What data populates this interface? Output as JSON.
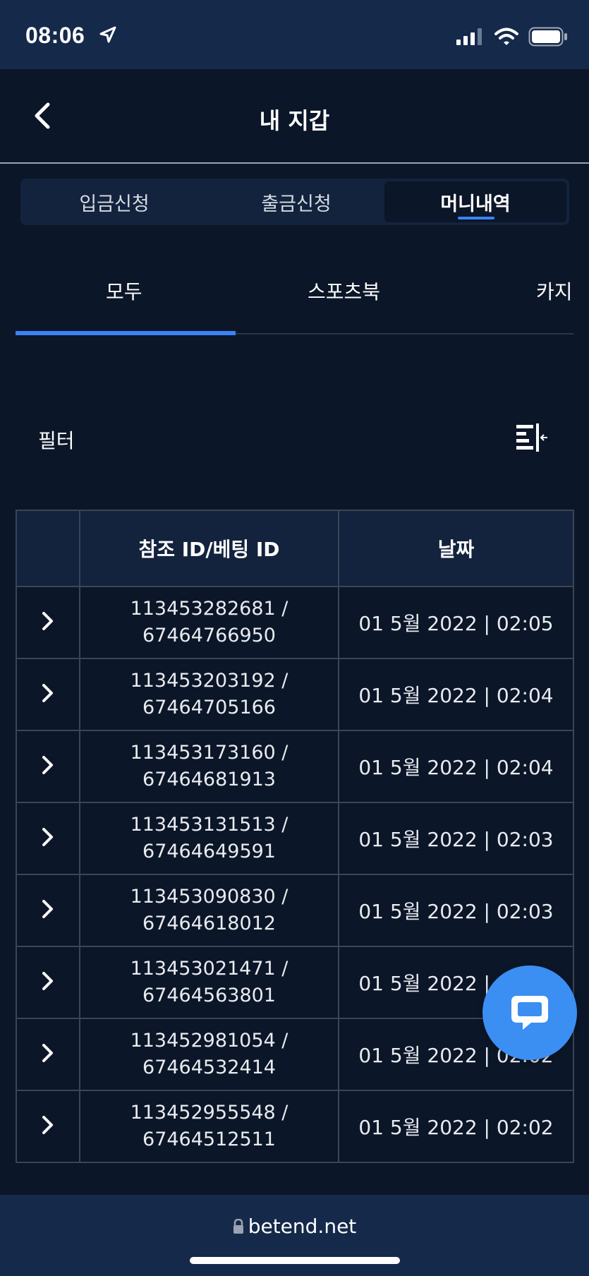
{
  "status": {
    "time": "08:06"
  },
  "header": {
    "title": "내 지갑"
  },
  "segment": {
    "items": [
      "입금신청",
      "출금신청",
      "머니내역"
    ],
    "active_index": 2
  },
  "tabs": {
    "items": [
      "모두",
      "스포츠북",
      "카지"
    ],
    "active_index": 0
  },
  "filter": {
    "label": "필터"
  },
  "table": {
    "headers": [
      "",
      "참조 ID/베팅 ID",
      "날짜"
    ],
    "rows": [
      {
        "ref_id": "113453282681 /",
        "bet_id": "67464766950",
        "date": "01 5월 2022 | 02:05"
      },
      {
        "ref_id": "113453203192 /",
        "bet_id": "67464705166",
        "date": "01 5월 2022 | 02:04"
      },
      {
        "ref_id": "113453173160 /",
        "bet_id": "67464681913",
        "date": "01 5월 2022 | 02:04"
      },
      {
        "ref_id": "113453131513 /",
        "bet_id": "67464649591",
        "date": "01 5월 2022 | 02:03"
      },
      {
        "ref_id": "113453090830 /",
        "bet_id": "67464618012",
        "date": "01 5월 2022 | 02:03"
      },
      {
        "ref_id": "113453021471 /",
        "bet_id": "67464563801",
        "date": "01 5월 2022 | 02:03"
      },
      {
        "ref_id": "113452981054 /",
        "bet_id": "67464532414",
        "date": "01 5월 2022 | 02:02"
      },
      {
        "ref_id": "113452955548 /",
        "bet_id": "67464512511",
        "date": "01 5월 2022 | 02:02"
      }
    ]
  },
  "browser": {
    "url": "betend.net"
  },
  "colors": {
    "background": "#0b1628",
    "header_bg": "#13233d",
    "accent": "#3b82f6",
    "chat_button": "#3b8ef2"
  },
  "icons": [
    "location-arrow-icon",
    "signal-icon",
    "wifi-icon",
    "battery-icon",
    "back-chevron-icon",
    "filter-icon",
    "chevron-right-icon",
    "chat-icon",
    "lock-icon"
  ]
}
